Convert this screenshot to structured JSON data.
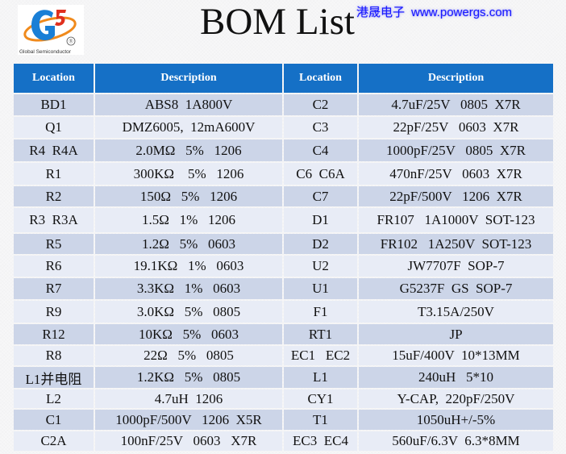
{
  "logo": {
    "mark": "G5",
    "registered": "®",
    "caption": "Global Semiconductor",
    "colors": {
      "blue": "#1a7fd6",
      "orange": "#f08a1c",
      "red": "#e0301e"
    }
  },
  "title": "BOM List",
  "brand": {
    "name": "港晟电子",
    "url": "www.powergs.com",
    "color": "#1a1aff"
  },
  "table": {
    "headers": [
      "Location",
      "Description",
      "Location",
      "Description"
    ],
    "colors": {
      "header_bg": "#1570c6",
      "row_dark": "#ccd5e8",
      "row_light": "#e8ecf6"
    },
    "rows": [
      {
        "loc1": "BD1",
        "desc1": "ABS8  1A800V",
        "loc2": "C2",
        "desc2": "4.7uF/25V   0805  X7R"
      },
      {
        "loc1": "Q1",
        "desc1": "DMZ6005,  12mA600V",
        "loc2": "C3",
        "desc2": "22pF/25V   0603  X7R"
      },
      {
        "loc1": "R4  R4A",
        "desc1": "2.0MΩ   5%   1206",
        "loc2": "C4",
        "desc2": "1000pF/25V   0805  X7R"
      },
      {
        "loc1": "R1",
        "desc1": "300KΩ    5%   1206",
        "loc2": "C6  C6A",
        "desc2": "470nF/25V   0603  X7R"
      },
      {
        "loc1": "R2",
        "desc1": "150Ω   5%   1206",
        "loc2": "C7",
        "desc2": "22pF/500V   1206  X7R"
      },
      {
        "loc1": "R3  R3A",
        "desc1": "1.5Ω   1%   1206",
        "loc2": "D1",
        "desc2": "FR107   1A1000V  SOT-123"
      },
      {
        "loc1": "R5",
        "desc1": "1.2Ω   5%   0603",
        "loc2": "D2",
        "desc2": "FR102   1A250V  SOT-123"
      },
      {
        "loc1": "R6",
        "desc1": "19.1KΩ   1%   0603",
        "loc2": "U2",
        "desc2": "JW7707F  SOP-7"
      },
      {
        "loc1": "R7",
        "desc1": "3.3KΩ   1%   0603",
        "loc2": "U1",
        "desc2": "G5237F  GS  SOP-7"
      },
      {
        "loc1": "R9",
        "desc1": "3.0KΩ   5%   0805",
        "loc2": "F1",
        "desc2": "T3.15A/250V"
      },
      {
        "loc1": "R12",
        "desc1": "10KΩ   5%   0603",
        "loc2": "RT1",
        "desc2": "JP"
      },
      {
        "loc1": "R8",
        "desc1": "22Ω   5%   0805",
        "loc2": "EC1   EC2",
        "desc2": "15uF/400V  10*13MM"
      },
      {
        "loc1": "L1并电阻",
        "desc1": "1.2KΩ   5%   0805",
        "loc2": "L1",
        "desc2": "240uH   5*10"
      },
      {
        "loc1": "L2",
        "desc1": "4.7uH  1206",
        "loc2": "CY1",
        "desc2": "Y-CAP,  220pF/250V"
      },
      {
        "loc1": "C1",
        "desc1": "1000pF/500V   1206  X5R",
        "loc2": "T1",
        "desc2": "1050uH+/-5%"
      },
      {
        "loc1": "C2A",
        "desc1": "100nF/25V   0603   X7R",
        "loc2": "EC3  EC4",
        "desc2": "560uF/6.3V  6.3*8MM"
      }
    ]
  }
}
